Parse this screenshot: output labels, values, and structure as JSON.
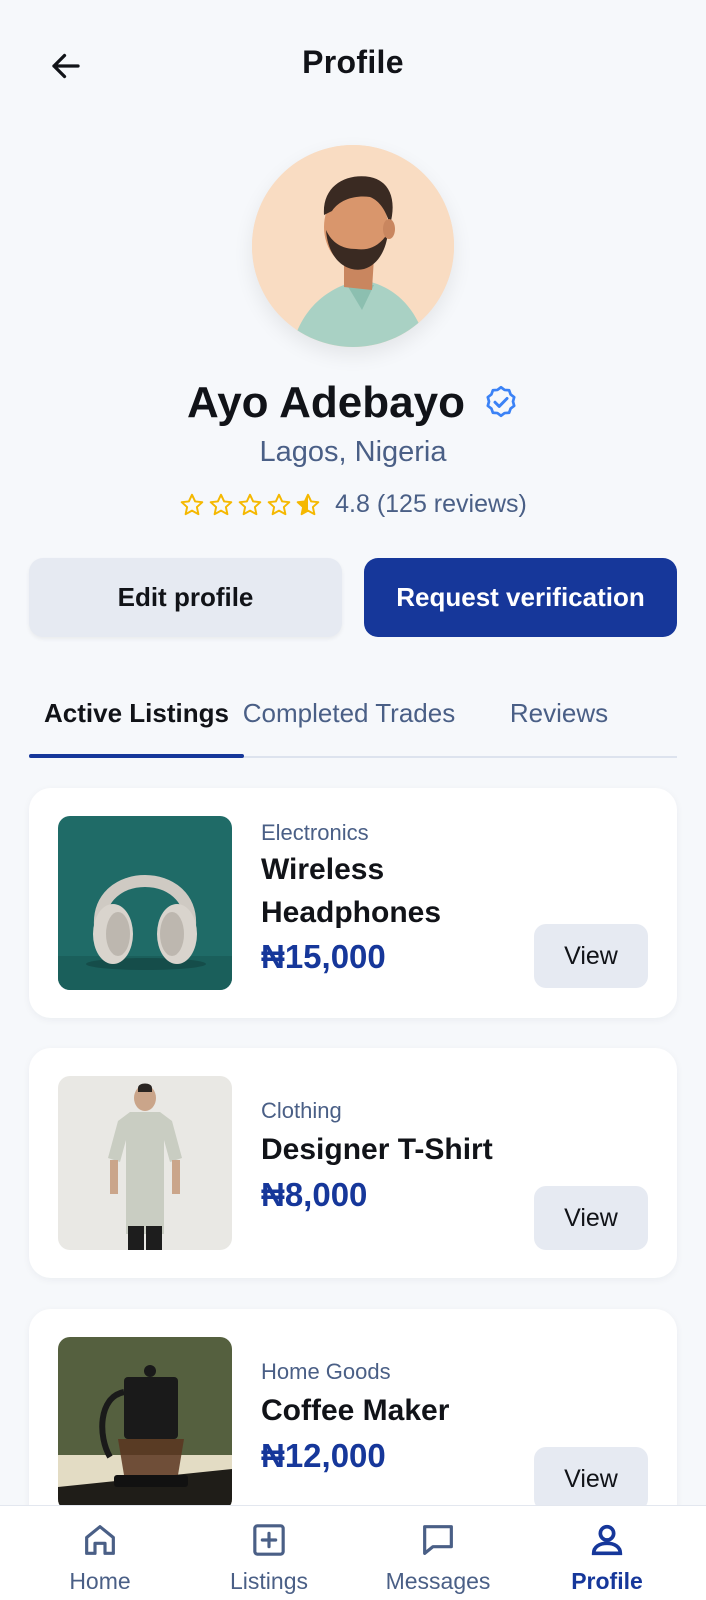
{
  "header": {
    "title": "Profile",
    "back_icon": "arrow-left-icon"
  },
  "profile": {
    "name": "Ayo Adebayo",
    "location": "Lagos, Nigeria",
    "rating_text": "4.8 (125 reviews)",
    "rating": 4.5,
    "verified": true
  },
  "actions": {
    "edit_label": "Edit profile",
    "verify_label": "Request verification"
  },
  "tabs": [
    {
      "label": "Active Listings",
      "active": true
    },
    {
      "label": "Completed Trades",
      "active": false
    },
    {
      "label": "Reviews",
      "active": false
    }
  ],
  "listings": [
    {
      "category": "Electronics",
      "title": "Wireless Headphones",
      "price": "₦15,000",
      "view_label": "View"
    },
    {
      "category": "Clothing",
      "title": "Designer T-Shirt",
      "price": "₦8,000",
      "view_label": "View"
    },
    {
      "category": "Home Goods",
      "title": "Coffee Maker",
      "price": "₦12,000",
      "view_label": "View"
    }
  ],
  "nav": [
    {
      "label": "Home",
      "icon": "home-icon",
      "active": false
    },
    {
      "label": "Listings",
      "icon": "plus-square-icon",
      "active": false
    },
    {
      "label": "Messages",
      "icon": "message-icon",
      "active": false
    },
    {
      "label": "Profile",
      "icon": "user-icon",
      "active": true
    }
  ],
  "colors": {
    "accent": "#16379a",
    "muted": "#4a5f86",
    "star": "#f5b800",
    "verified": "#3b82f6",
    "background": "#f6f8fb"
  }
}
